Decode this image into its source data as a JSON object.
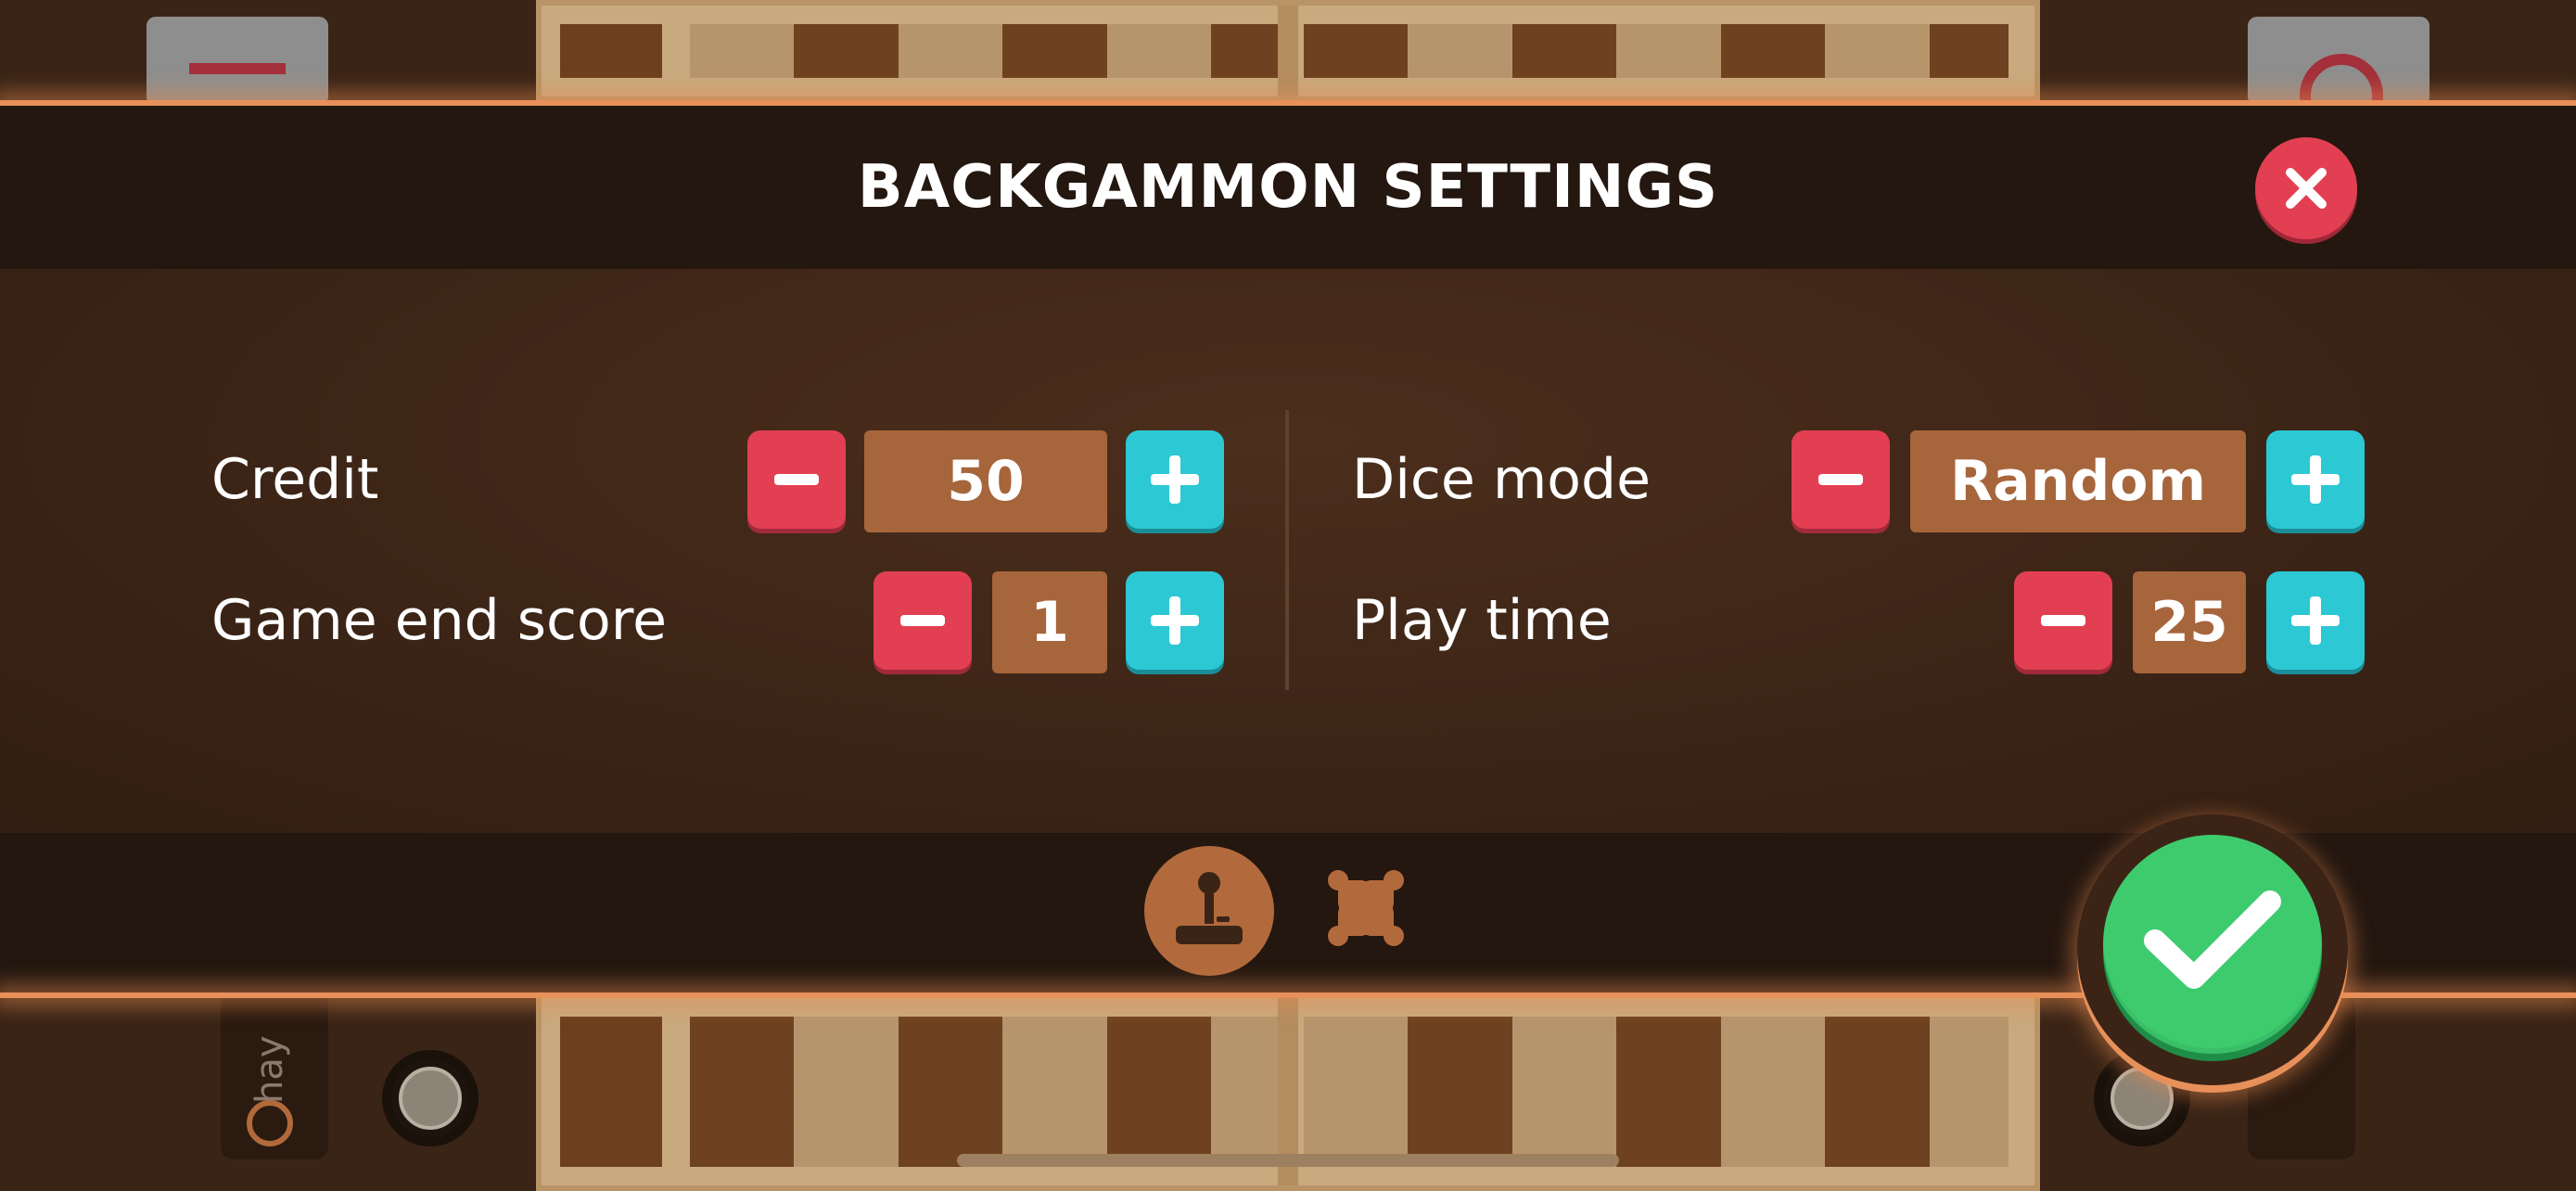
{
  "modal": {
    "title": "BACKGAMMON SETTINGS"
  },
  "settings": {
    "credit": {
      "label": "Credit",
      "value": "50"
    },
    "game_end_score": {
      "label": "Game end score",
      "value": "1"
    },
    "dice_mode": {
      "label": "Dice mode",
      "value": "Random"
    },
    "play_time": {
      "label": "Play time",
      "value": "25"
    }
  },
  "player": {
    "name_fragment": "hay"
  },
  "colors": {
    "minus": "#e23f52",
    "plus": "#2cc8d4",
    "value_box": "#a7653c",
    "confirm": "#3dcb6e",
    "header_bg": "#241710"
  },
  "icons": {
    "close": "close-icon",
    "minus": "minus-icon",
    "plus": "plus-icon",
    "tab_game": "joystick-icon",
    "tab_rules": "puzzle-icon",
    "confirm": "checkmark-icon"
  }
}
